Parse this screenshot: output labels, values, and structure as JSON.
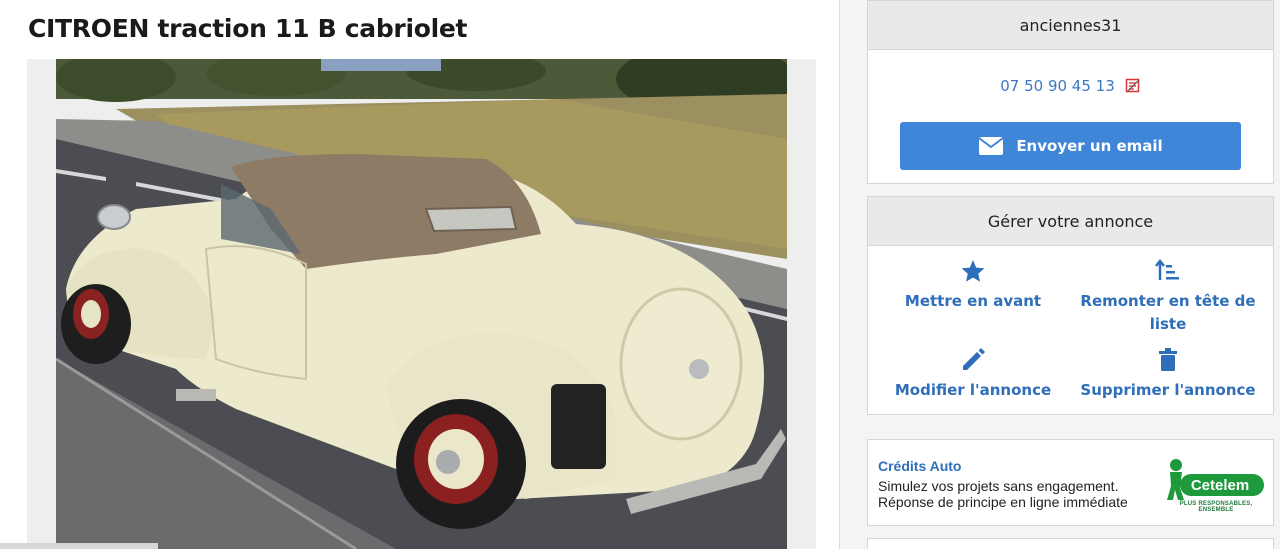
{
  "listing": {
    "title": "CITROEN traction 11 B cabriolet"
  },
  "seller": {
    "name": "anciennes31",
    "phone": "07 50 90 45 13",
    "email_button_label": "Envoyer un email"
  },
  "manage": {
    "heading": "Gérer votre annonce",
    "actions": [
      {
        "label": "Mettre en avant",
        "icon": "star-icon"
      },
      {
        "label": "Remonter en tête de liste",
        "icon": "sort-up-icon"
      },
      {
        "label": "Modifier l'annonce",
        "icon": "pencil-icon"
      },
      {
        "label": "Supprimer l'annonce",
        "icon": "trash-icon"
      }
    ]
  },
  "ad": {
    "title": "Crédits Auto",
    "line1": "Simulez vos projets sans engagement.",
    "line2": "Réponse de principe en ligne immédiate",
    "logo_text": "Cetelem",
    "slogan": "PLUS RESPONSABLES, ENSEMBLE",
    "brand_color": "#1e9a3c"
  },
  "colors": {
    "accent": "#3f86d9",
    "link": "#2f6eb8"
  }
}
